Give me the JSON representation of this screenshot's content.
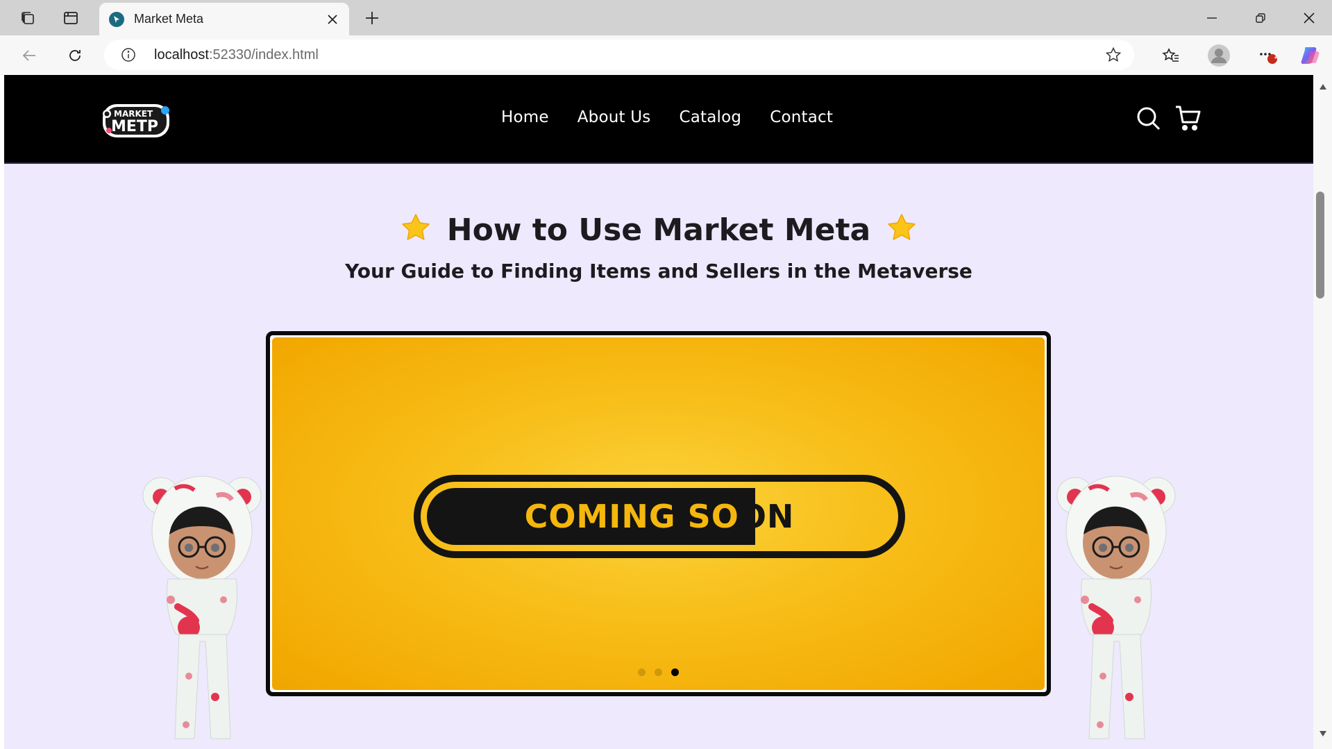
{
  "browser": {
    "tab_title": "Market Meta",
    "url_host": "localhost",
    "url_rest": ":52330/index.html",
    "notification_count": "1"
  },
  "site": {
    "logo_text": "MARKET META",
    "nav": [
      "Home",
      "About Us",
      "Catalog",
      "Contact"
    ],
    "headline": "How to Use Market Meta",
    "subheadline": "Your Guide to Finding Items and Sellers in the Metaverse",
    "slide_text_light": "COMING SO",
    "slide_text_dark": "ON",
    "slide_count": 3,
    "active_slide": 3
  },
  "colors": {
    "header_bg": "#000000",
    "page_bg": "#eee9fc",
    "slide_yellow": "#f8bf1b",
    "badge_dark": "#141414"
  },
  "icons": [
    "workspaces-icon",
    "tab-actions-icon",
    "close-icon",
    "plus-icon",
    "minimize-icon",
    "restore-icon",
    "back-icon",
    "refresh-icon",
    "info-icon",
    "star-outline-icon",
    "favorites-icon",
    "profile-icon",
    "more-icon",
    "copilot-icon",
    "search-icon",
    "cart-icon",
    "star-icon"
  ]
}
